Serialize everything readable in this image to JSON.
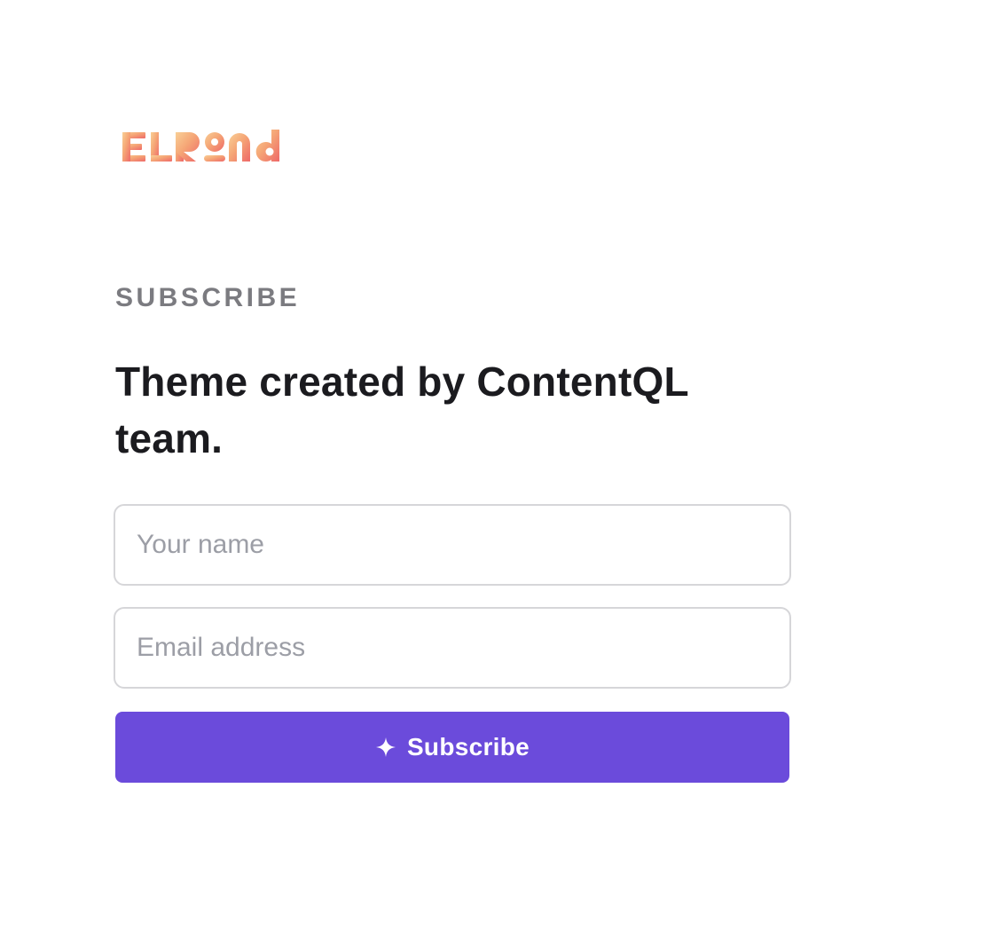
{
  "brand": {
    "logo_text": "ELROND",
    "gradient": [
      "#f7c48a",
      "#f4a373",
      "#ef6c6c"
    ]
  },
  "section": {
    "eyebrow": "SUBSCRIBE",
    "headline": "Theme created by ContentQL team."
  },
  "form": {
    "name_placeholder": "Your name",
    "name_value": "",
    "email_placeholder": "Email address",
    "email_value": "",
    "submit_label": "Subscribe",
    "submit_icon": "sparkle-icon",
    "accent": "#6b4bdb"
  }
}
